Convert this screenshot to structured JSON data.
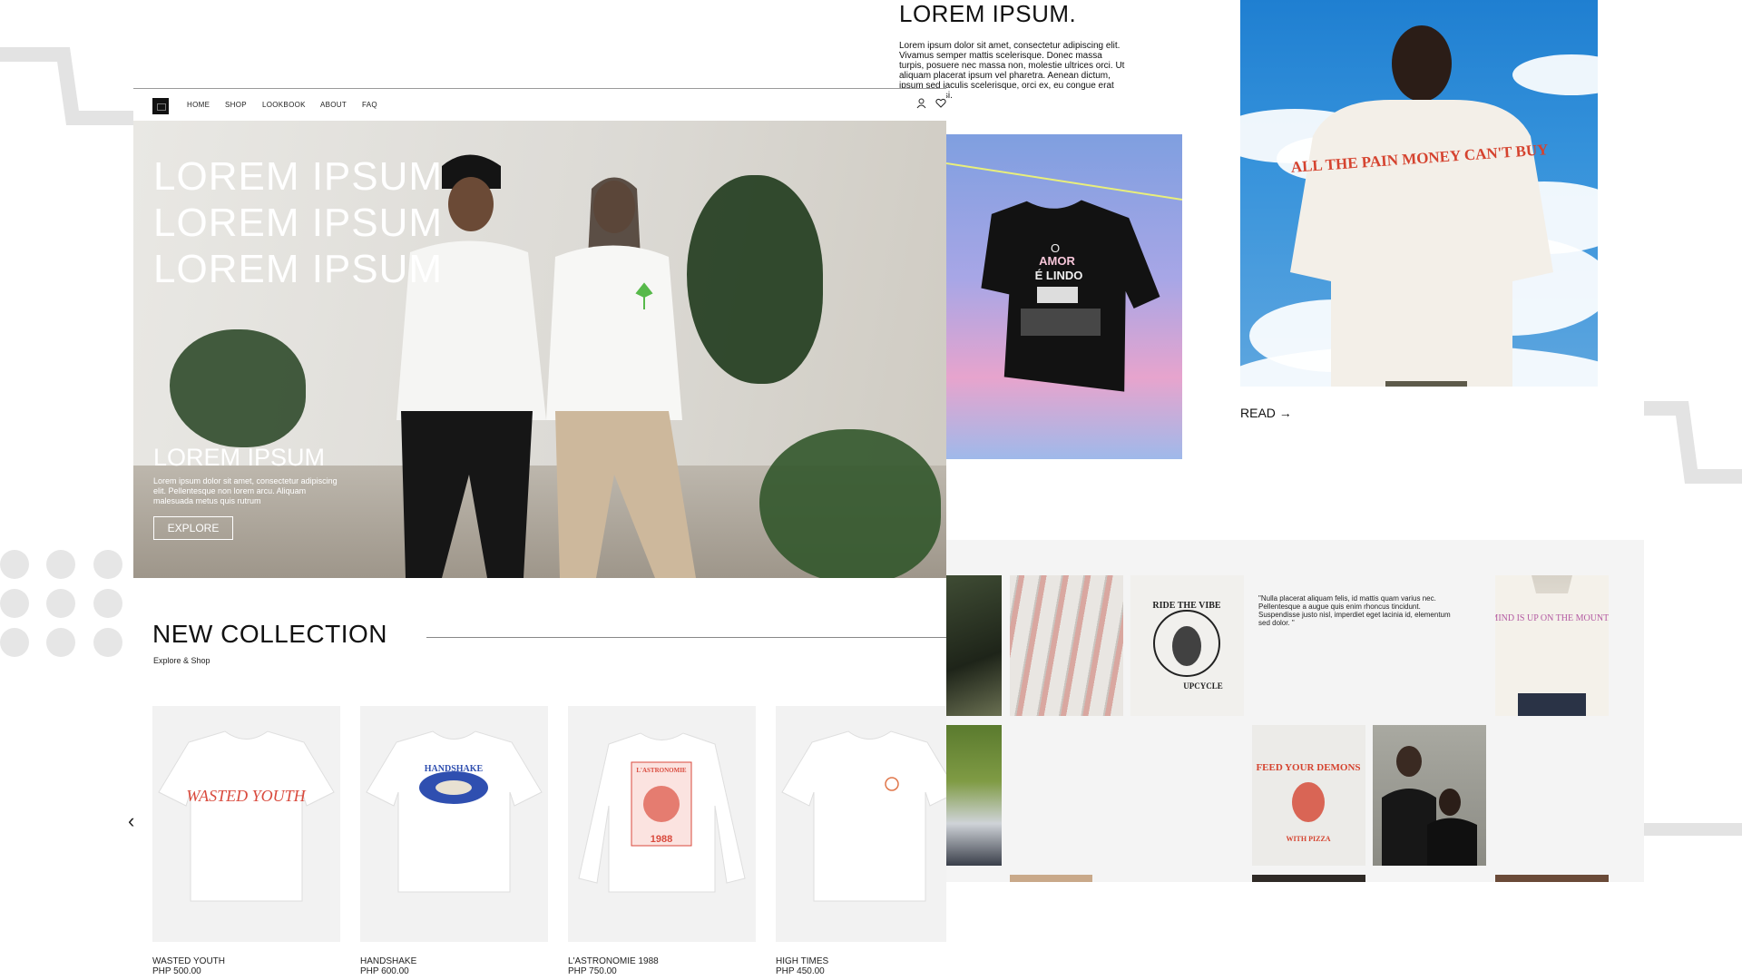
{
  "nav": {
    "items": [
      "HOME",
      "SHOP",
      "LOOKBOOK",
      "ABOUT",
      "FAQ"
    ],
    "icons": [
      "user-icon",
      "heart-icon"
    ]
  },
  "hero": {
    "title_lines": [
      "LOREM IPSUM",
      "LOREM IPSUM",
      "LOREM IPSUM"
    ],
    "subtitle": "LOREM IPSUM",
    "description": "Lorem ipsum dolor sit amet, consectetur adipiscing elit. Pellentesque non lorem arcu. Aliquam malesuada metus quis rutrum",
    "button": "EXPLORE"
  },
  "collection": {
    "title": "NEW COLLECTION",
    "subtitle": "Explore & Shop",
    "products": [
      {
        "name": "WASTED YOUTH",
        "price": "PHP 500.00"
      },
      {
        "name": "HANDSHAKE",
        "price": "PHP 600.00"
      },
      {
        "name": "L'ASTRONOMIE 1988",
        "price": "PHP 750.00"
      },
      {
        "name": "HIGH TIMES",
        "price": "PHP 450.00"
      }
    ]
  },
  "blog": {
    "title": "LOREM IPSUM.",
    "text": "Lorem ipsum dolor sit amet, consectetur adipiscing elit. Vivamus semper mattis scelerisque. Donec massa turpis, posuere nec massa non, molestie ultrices orci. Ut aliquam placerat ipsum vel pharetra. Aenean dictum, ipsum sed iaculis scelerisque, orci ex, eu congue erat arcu nec nisi.",
    "read_label": "READ →"
  },
  "graphics": {
    "shirt1_text": "WASTED YOUTH",
    "shirt2_text": "HANDSHAKE",
    "shirt3_text": "L'ASTRONOMIE",
    "shirt3_year": "1988",
    "sky_shirt_lines": [
      "O",
      "AMOR",
      "É LINDO"
    ],
    "back_shirt_text": "ALL THE PAIN MONEY CAN'T BUY",
    "gallery_shirt1_text": "RIDE THE VIBE",
    "gallery_shirt1_sub": "UPCYCLE",
    "gallery_shirt2_text": "MY MIND IS UP ON THE MOUNTAINS",
    "gallery_shirt3_text": "FEED YOUR DEMONS",
    "gallery_shirt3_sub": "WITH PIZZA"
  },
  "gallery": {
    "quote": "\"Nulla placerat aliquam felis, id mattis quam varius nec. Pellentesque a augue quis enim rhoncus tincidunt. Suspendisse justo nisl, imperdiet eget lacinia id, elementum sed dolor. \""
  },
  "colors": {
    "accent_red": "#d94a3d",
    "accent_blue": "#2f4fb0",
    "text": "#111111",
    "gallery_bg": "#f4f4f4"
  }
}
